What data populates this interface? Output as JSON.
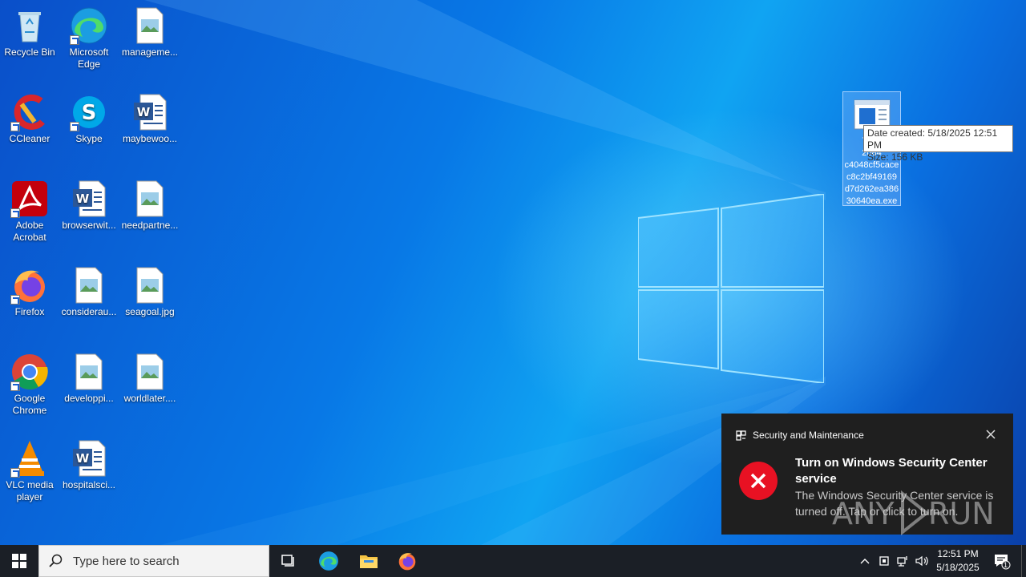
{
  "desktop": {
    "icons": [
      {
        "label": "Recycle Bin",
        "icon": "recycle-bin-icon"
      },
      {
        "label": "Microsoft Edge",
        "icon": "edge-icon"
      },
      {
        "label": "manageme...",
        "icon": "image-file-icon"
      },
      {
        "label": "CCleaner",
        "icon": "ccleaner-icon"
      },
      {
        "label": "Skype",
        "icon": "skype-icon"
      },
      {
        "label": "maybewoo...",
        "icon": "word-doc-icon"
      },
      {
        "label": "Adobe Acrobat",
        "icon": "acrobat-icon"
      },
      {
        "label": "browserwit...",
        "icon": "word-doc-icon"
      },
      {
        "label": "needpartne...",
        "icon": "image-file-icon"
      },
      {
        "label": "Firefox",
        "icon": "firefox-icon"
      },
      {
        "label": "considerau...",
        "icon": "image-file-icon"
      },
      {
        "label": "seagoal.jpg",
        "icon": "image-file-icon"
      },
      {
        "label": "Google Chrome",
        "icon": "chrome-icon"
      },
      {
        "label": "developpi...",
        "icon": "image-file-icon"
      },
      {
        "label": "worldlater....",
        "icon": "image-file-icon"
      },
      {
        "label": "VLC media player",
        "icon": "vlc-icon"
      },
      {
        "label": "hospitalsci...",
        "icon": "word-doc-icon"
      }
    ],
    "selected_file": {
      "name_lines": [
        "7de7",
        "2084",
        "c4048cf5cace",
        "c8c2bf49169",
        "d7d262ea386",
        "30640ea.exe"
      ],
      "icon": "executable-icon"
    },
    "tooltip": {
      "date_created": "Date created: 5/18/2025 12:51 PM",
      "size": "Size: 156 KB"
    }
  },
  "toast": {
    "app_name": "Security and Maintenance",
    "title": "Turn on Windows Security Center service",
    "body": "The Windows Security Center service is turned off. Tap or click to turn on.",
    "watermark": "ANY RUN"
  },
  "taskbar": {
    "search_placeholder": "Type here to search",
    "time": "12:51 PM",
    "date": "5/18/2025",
    "notification_count": "1"
  },
  "colors": {
    "taskbar_bg": "#1b1f26",
    "toast_bg": "#1f1f1f",
    "error_red": "#e81123",
    "desktop_blue": "#0878e6"
  }
}
